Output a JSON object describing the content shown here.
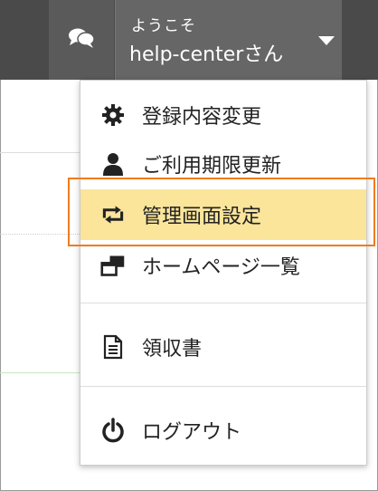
{
  "header": {
    "chat_icon": "chat-bubbles-icon",
    "greeting": "ようこそ",
    "username": "help-centerさん",
    "caret_icon": "caret-down-icon"
  },
  "menu": {
    "items": [
      {
        "label": "登録内容変更",
        "icon": "gear-icon"
      },
      {
        "label": "ご利用期限更新",
        "icon": "person-icon"
      },
      {
        "label": "管理画面設定",
        "icon": "swap-arrows-icon",
        "highlighted": true
      },
      {
        "label": "ホームページ一覧",
        "icon": "windows-icon"
      },
      {
        "label": "領収書",
        "icon": "document-icon"
      },
      {
        "label": "ログアウト",
        "icon": "power-icon"
      }
    ]
  },
  "colors": {
    "topbar": "#4a4a4a",
    "user_button": "#666666",
    "highlight": "#fae59a",
    "focus_outline": "#f07b1f"
  }
}
